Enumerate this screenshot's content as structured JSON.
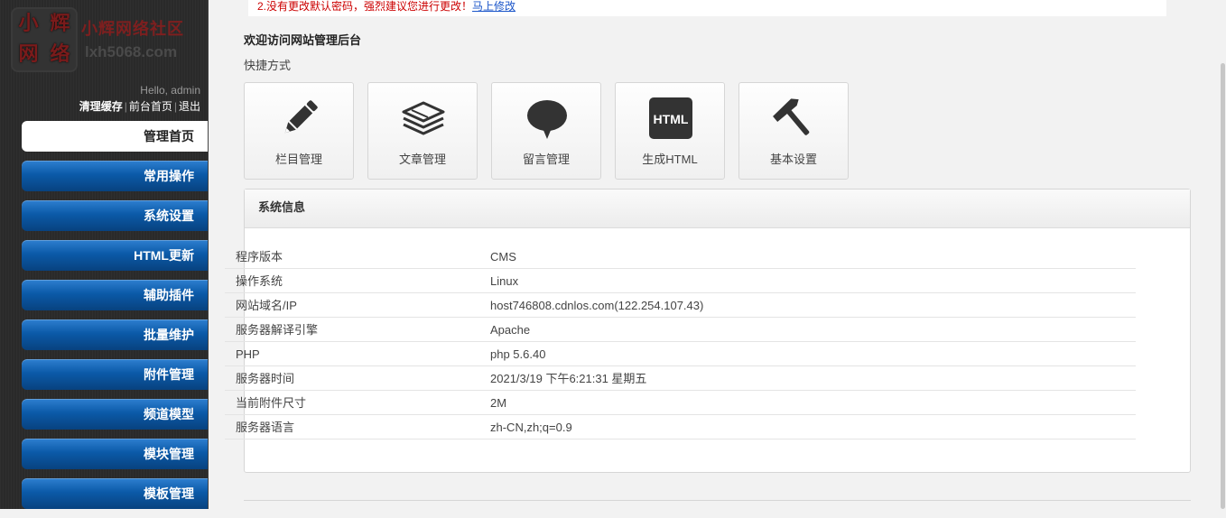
{
  "logo": {
    "badge_chars": [
      "小",
      "辉",
      "网",
      "络"
    ],
    "site_name": "小辉网络社区",
    "site_url": "lxh5068.com"
  },
  "user": {
    "greeting": "Hello, admin",
    "links": [
      "清理缓存",
      "前台首页",
      "退出"
    ]
  },
  "sidebar": {
    "items": [
      {
        "label": "管理首页",
        "active": true
      },
      {
        "label": "常用操作"
      },
      {
        "label": "系统设置"
      },
      {
        "label": "HTML更新"
      },
      {
        "label": "辅助插件"
      },
      {
        "label": "批量维护"
      },
      {
        "label": "附件管理"
      },
      {
        "label": "频道模型"
      },
      {
        "label": "模块管理"
      },
      {
        "label": "模板管理"
      }
    ]
  },
  "notice": {
    "text": "2.没有更改默认密码，强烈建议您进行更改！",
    "link": "马上修改"
  },
  "main": {
    "welcome": "欢迎访问网站管理后台",
    "shortcut_title": "快捷方式",
    "shortcuts": [
      {
        "label": "栏目管理",
        "icon": "pencil-icon"
      },
      {
        "label": "文章管理",
        "icon": "layers-icon"
      },
      {
        "label": "留言管理",
        "icon": "speech-bubble-icon"
      },
      {
        "label": "生成HTML",
        "icon": "html-icon"
      },
      {
        "label": "基本设置",
        "icon": "hammer-icon"
      }
    ],
    "html_badge": "HTML"
  },
  "system_info": {
    "title": "系统信息",
    "rows": [
      {
        "key": "程序版本",
        "value": "CMS"
      },
      {
        "key": "操作系统",
        "value": "Linux"
      },
      {
        "key": "网站域名/IP",
        "value": "host746808.cdnlos.com(122.254.107.43)"
      },
      {
        "key": "服务器解译引擎",
        "value": "Apache"
      },
      {
        "key": "PHP",
        "value": "php 5.6.40"
      },
      {
        "key": "服务器时间",
        "value": "2021/3/19 下午6:21:31 星期五"
      },
      {
        "key": "当前附件尺寸",
        "value": "2M"
      },
      {
        "key": "服务器语言",
        "value": "zh-CN,zh;q=0.9"
      }
    ]
  },
  "colors": {
    "menu_blue": "#0b5aa8",
    "sidebar_bg": "#2a2a2a",
    "logo_red": "#7e1f1f",
    "notice_red": "#cc0000"
  }
}
